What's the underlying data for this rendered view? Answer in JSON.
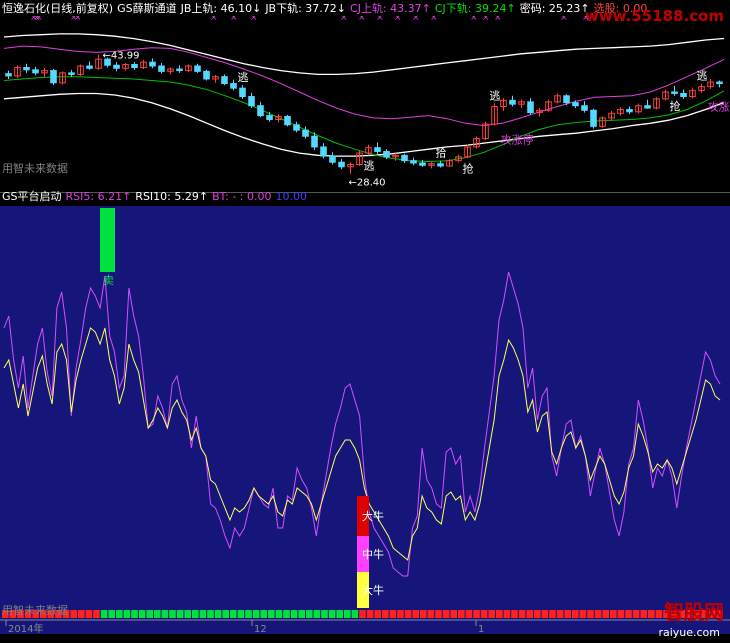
{
  "colors": {
    "bg": "#000000",
    "sub_bg": "#16167a",
    "grid": "#5a5a5a",
    "up": "#ff4040",
    "down": "#54d8ff",
    "white_line": "#ffffff",
    "magenta": "#e040e0",
    "green": "#00c000",
    "yellow": "#ffff60",
    "purple_rsi": "#d050ff",
    "red_bar": "#e00000",
    "green_bar": "#00e040"
  },
  "top_header": {
    "items": [
      {
        "text": "恒逸石化(日线,前复权)",
        "color": "#ffffff"
      },
      {
        "text": "GS薛斯通道",
        "color": "#ffffff"
      },
      {
        "text": "JB上轨: 46.10↓",
        "color": "#ffffff"
      },
      {
        "text": "JB下轨: 37.72↓",
        "color": "#ffffff"
      },
      {
        "text": "CJ上轨: 43.37↑",
        "color": "#e040e0"
      },
      {
        "text": "CJ下轨: 39.24↑",
        "color": "#00e000"
      },
      {
        "text": "密码: 25.23↑",
        "color": "#ffffff"
      },
      {
        "text": "选股: 0.00",
        "color": "#ff4040"
      }
    ]
  },
  "watermark_top": "www.55188.com",
  "watermark_bottom": {
    "cn": "智股网",
    "en": "raiyue.com"
  },
  "sub_header": {
    "items": [
      {
        "text": "GS平台启动",
        "color": "#ffffff"
      },
      {
        "text": "RSI5: 6.21↑",
        "color": "#e040e0"
      },
      {
        "text": "RSI10: 5.29↑",
        "color": "#ffffff"
      },
      {
        "text": "BT: - : 0.00",
        "color": "#e040e0"
      },
      {
        "text": "10.00",
        "color": "#4040ff"
      }
    ]
  },
  "annotations": {
    "price_high": "←43.99",
    "price_low": "←28.40",
    "main_note": "用智未来数据",
    "sub_note": "用智未来数据",
    "x_labels": [
      "2014年",
      "12",
      "1"
    ]
  },
  "chart_data": [
    {
      "type": "candlestick",
      "title": "恒逸石化(日线,前复权)",
      "indicator": "GS薛斯通道",
      "ylim": [
        26,
        48
      ],
      "candles": [
        [
          41.5,
          41.9,
          40.8,
          41.2
        ],
        [
          41.2,
          42.6,
          40.9,
          42.3
        ],
        [
          42.3,
          42.8,
          41.6,
          42.0
        ],
        [
          42.0,
          42.4,
          41.3,
          41.6
        ],
        [
          41.6,
          42.2,
          41.0,
          41.9
        ],
        [
          41.9,
          42.1,
          40.0,
          40.3
        ],
        [
          40.3,
          41.8,
          40.1,
          41.6
        ],
        [
          41.6,
          42.0,
          41.1,
          41.4
        ],
        [
          41.4,
          42.7,
          41.2,
          42.5
        ],
        [
          42.5,
          43.1,
          42.0,
          42.2
        ],
        [
          42.2,
          43.99,
          42.0,
          43.4
        ],
        [
          43.4,
          43.6,
          42.3,
          42.6
        ],
        [
          42.6,
          43.0,
          41.8,
          42.2
        ],
        [
          42.2,
          42.9,
          41.9,
          42.7
        ],
        [
          42.7,
          43.0,
          42.0,
          42.3
        ],
        [
          42.3,
          43.3,
          42.1,
          43.0
        ],
        [
          43.0,
          43.5,
          42.2,
          42.5
        ],
        [
          42.5,
          42.9,
          41.5,
          41.8
        ],
        [
          41.8,
          42.3,
          41.4,
          42.1
        ],
        [
          42.1,
          42.6,
          41.6,
          41.9
        ],
        [
          41.9,
          42.7,
          41.7,
          42.5
        ],
        [
          42.5,
          42.8,
          41.6,
          41.8
        ],
        [
          41.8,
          42.0,
          40.6,
          40.8
        ],
        [
          40.8,
          41.3,
          40.3,
          41.1
        ],
        [
          41.1,
          41.4,
          40.0,
          40.2
        ],
        [
          40.2,
          40.7,
          39.3,
          39.6
        ],
        [
          39.6,
          40.0,
          38.2,
          38.5
        ],
        [
          38.5,
          39.0,
          37.0,
          37.3
        ],
        [
          37.3,
          37.8,
          35.8,
          36.0
        ],
        [
          36.0,
          36.5,
          35.2,
          35.5
        ],
        [
          35.5,
          36.2,
          35.1,
          35.9
        ],
        [
          35.9,
          36.1,
          34.6,
          34.8
        ],
        [
          34.8,
          35.2,
          33.8,
          34.1
        ],
        [
          34.1,
          34.6,
          33.0,
          33.3
        ],
        [
          33.3,
          33.8,
          31.5,
          31.9
        ],
        [
          31.9,
          32.4,
          30.4,
          30.7
        ],
        [
          30.7,
          31.2,
          29.6,
          29.9
        ],
        [
          29.9,
          30.3,
          29.0,
          29.3
        ],
        [
          29.3,
          29.9,
          28.4,
          29.6
        ],
        [
          29.6,
          31.4,
          29.4,
          31.1
        ],
        [
          31.1,
          32.2,
          30.8,
          31.8
        ],
        [
          31.8,
          32.5,
          31.0,
          31.3
        ],
        [
          31.3,
          31.6,
          30.3,
          30.6
        ],
        [
          30.6,
          31.1,
          30.1,
          30.8
        ],
        [
          30.8,
          31.0,
          29.8,
          30.1
        ],
        [
          30.1,
          30.5,
          29.5,
          29.8
        ],
        [
          29.8,
          30.2,
          29.3,
          29.5
        ],
        [
          29.5,
          29.9,
          29.1,
          29.7
        ],
        [
          29.7,
          30.1,
          29.2,
          29.4
        ],
        [
          29.4,
          30.3,
          29.3,
          30.1
        ],
        [
          30.1,
          30.9,
          29.9,
          30.6
        ],
        [
          30.6,
          32.2,
          30.4,
          31.9
        ],
        [
          31.9,
          33.3,
          31.7,
          33.0
        ],
        [
          33.0,
          35.2,
          32.8,
          34.9
        ],
        [
          34.9,
          37.6,
          34.7,
          37.2
        ],
        [
          37.2,
          38.3,
          36.6,
          38.0
        ],
        [
          38.0,
          38.6,
          37.2,
          37.5
        ],
        [
          37.5,
          38.1,
          37.0,
          37.8
        ],
        [
          37.8,
          38.3,
          36.1,
          36.4
        ],
        [
          36.4,
          37.0,
          35.9,
          36.7
        ],
        [
          36.7,
          38.1,
          36.5,
          37.8
        ],
        [
          37.8,
          38.9,
          37.6,
          38.6
        ],
        [
          38.6,
          38.8,
          37.4,
          37.7
        ],
        [
          37.7,
          38.0,
          37.0,
          37.3
        ],
        [
          37.3,
          37.9,
          36.4,
          36.7
        ],
        [
          36.7,
          36.9,
          34.3,
          34.6
        ],
        [
          34.6,
          35.9,
          34.4,
          35.7
        ],
        [
          35.7,
          36.6,
          35.3,
          36.3
        ],
        [
          36.3,
          37.1,
          36.0,
          36.8
        ],
        [
          36.8,
          37.2,
          36.2,
          36.5
        ],
        [
          36.5,
          37.6,
          36.3,
          37.3
        ],
        [
          37.3,
          38.1,
          36.9,
          37.0
        ],
        [
          37.0,
          38.4,
          36.8,
          38.2
        ],
        [
          38.2,
          39.4,
          38.0,
          39.1
        ],
        [
          39.1,
          39.9,
          38.6,
          38.9
        ],
        [
          38.9,
          39.4,
          38.2,
          38.5
        ],
        [
          38.5,
          39.6,
          38.3,
          39.3
        ],
        [
          39.3,
          40.2,
          39.0,
          39.8
        ],
        [
          39.8,
          40.8,
          39.5,
          40.4
        ],
        [
          40.4,
          40.6,
          39.7,
          40.2
        ]
      ],
      "jb_upper": [
        46.3,
        46.5,
        46.6,
        46.7,
        46.7,
        46.6,
        46.4,
        46.1,
        45.7,
        45.2,
        44.6,
        44.0,
        43.4,
        42.8,
        42.3,
        41.9,
        41.6,
        41.4,
        41.4,
        41.5,
        41.7,
        42.0,
        42.3,
        42.6,
        42.9,
        43.2,
        43.5,
        43.8,
        44.1,
        44.3,
        44.5,
        44.7,
        44.8,
        44.9,
        45.0,
        45.1,
        45.3,
        45.6,
        45.9,
        46.1
      ],
      "jb_lower": [
        38.2,
        38.4,
        38.6,
        38.8,
        38.9,
        38.9,
        38.7,
        38.3,
        37.7,
        36.9,
        36.0,
        35.0,
        34.0,
        33.1,
        32.3,
        31.6,
        31.1,
        30.8,
        30.7,
        30.7,
        30.8,
        31.0,
        31.3,
        31.6,
        31.9,
        32.1,
        32.4,
        32.7,
        33.0,
        33.3,
        33.5,
        33.7,
        34.0,
        34.3,
        34.7,
        35.0,
        35.4,
        36.0,
        36.8,
        37.72
      ],
      "cj_upper": [
        44.8,
        45.1,
        45.0,
        44.7,
        44.4,
        44.3,
        44.4,
        44.7,
        44.9,
        44.8,
        44.3,
        43.6,
        42.9,
        42.1,
        41.2,
        40.2,
        39.1,
        38.0,
        37.0,
        36.2,
        35.7,
        35.6,
        35.8,
        36.0,
        35.6,
        35.0,
        34.7,
        35.0,
        35.7,
        36.5,
        37.2,
        37.9,
        38.4,
        38.5,
        38.6,
        39.1,
        40.0,
        41.1,
        42.2,
        43.37
      ],
      "cj_lower": [
        40.6,
        40.8,
        41.0,
        41.1,
        41.1,
        41.0,
        40.9,
        40.8,
        40.6,
        40.4,
        40.0,
        39.4,
        38.6,
        37.7,
        36.7,
        35.6,
        34.5,
        33.4,
        32.4,
        31.6,
        30.9,
        30.4,
        30.1,
        30.0,
        30.1,
        30.5,
        31.2,
        32.2,
        33.3,
        34.2,
        34.8,
        35.1,
        35.3,
        35.4,
        35.5,
        35.7,
        36.1,
        36.8,
        37.9,
        39.24
      ],
      "signals": [
        {
          "index": 26,
          "text": "逃",
          "color": "#ffffff"
        },
        {
          "index": 40,
          "text": "逃",
          "color": "#ffffff"
        },
        {
          "index": 48,
          "text": "拾",
          "color": "#ffffff"
        },
        {
          "index": 51,
          "text": "抢",
          "color": "#ffffff"
        },
        {
          "index": 54,
          "text": "逃",
          "color": "#ffffff"
        },
        {
          "index": 74,
          "text": "抢",
          "color": "#ffffff"
        },
        {
          "index": 77,
          "text": "逃",
          "color": "#ffffff"
        }
      ],
      "labels": [
        {
          "index": 54,
          "text": "攻涨停",
          "color": "#e040e0"
        },
        {
          "index": 77,
          "text": "攻涨停",
          "color": "#e040e0"
        }
      ],
      "x_marks": [
        [
          30,
          33,
          35
        ],
        [
          70,
          74
        ],
        [
          210,
          230,
          250
        ],
        [
          340,
          358,
          376,
          394,
          412,
          430
        ],
        [
          470,
          482,
          494
        ],
        [
          560,
          582
        ]
      ]
    },
    {
      "type": "line",
      "title": "GS平台启动",
      "ylim": [
        0,
        100
      ],
      "series": [
        {
          "name": "RSI5",
          "color": "#d050ff",
          "values": [
            70,
            73,
            62,
            55,
            63,
            50,
            58,
            66,
            70,
            59,
            53,
            75,
            79,
            70,
            48,
            60,
            67,
            75,
            80,
            78,
            75,
            83,
            68,
            64,
            55,
            58,
            80,
            73,
            68,
            58,
            45,
            46,
            53,
            50,
            45,
            56,
            58,
            52,
            49,
            40,
            48,
            40,
            38,
            26,
            25,
            22,
            18,
            15,
            20,
            18,
            20,
            25,
            30,
            28,
            26,
            25,
            30,
            20,
            20,
            28,
            27,
            35,
            32,
            30,
            25,
            18,
            26,
            33,
            40,
            46,
            50,
            55,
            56,
            52,
            48,
            33,
            24,
            20,
            18,
            16,
            14,
            10,
            9,
            8,
            8,
            20,
            23,
            40,
            32,
            30,
            26,
            25,
            39,
            40,
            36,
            38,
            24,
            28,
            24,
            30,
            40,
            49,
            58,
            72,
            77,
            84,
            80,
            76,
            70,
            55,
            60,
            47,
            53,
            55,
            38,
            33,
            40,
            46,
            47,
            40,
            43,
            38,
            28,
            34,
            40,
            36,
            29,
            22,
            18,
            24,
            36,
            40,
            52,
            47,
            40,
            30,
            35,
            33,
            37,
            33,
            25,
            33,
            40,
            46,
            52,
            58,
            64,
            62,
            58,
            56
          ]
        },
        {
          "name": "RSI10",
          "color": "#ffff60",
          "values": [
            60,
            62,
            56,
            50,
            56,
            48,
            54,
            60,
            63,
            56,
            51,
            64,
            66,
            62,
            49,
            57,
            62,
            66,
            70,
            69,
            66,
            70,
            62,
            58,
            51,
            55,
            66,
            62,
            59,
            52,
            45,
            47,
            50,
            48,
            45,
            50,
            52,
            49,
            47,
            42,
            45,
            40,
            38,
            32,
            31,
            28,
            25,
            22,
            25,
            24,
            25,
            27,
            30,
            28,
            27,
            26,
            28,
            24,
            23,
            27,
            26,
            30,
            29,
            28,
            26,
            22,
            26,
            30,
            34,
            38,
            40,
            42,
            42,
            40,
            37,
            30,
            26,
            24,
            22,
            20,
            18,
            15,
            14,
            13,
            12,
            18,
            20,
            28,
            25,
            24,
            22,
            21,
            28,
            29,
            27,
            28,
            22,
            24,
            22,
            26,
            33,
            40,
            47,
            58,
            62,
            67,
            65,
            62,
            58,
            49,
            52,
            44,
            48,
            49,
            39,
            36,
            40,
            43,
            44,
            40,
            42,
            38,
            32,
            35,
            38,
            36,
            32,
            28,
            26,
            29,
            35,
            38,
            46,
            43,
            39,
            34,
            36,
            35,
            37,
            35,
            31,
            35,
            39,
            43,
            47,
            52,
            57,
            56,
            53,
            52
          ]
        }
      ],
      "bars": [
        {
          "text": "卖",
          "color": "#00e040",
          "top": 100,
          "bottom": 84
        },
        {
          "text": "大牛",
          "color": "#e00000",
          "top": 28,
          "bottom": 18
        },
        {
          "text": "中牛",
          "color": "#ff40ff",
          "top": 18,
          "bottom": 9
        },
        {
          "text": "大牛",
          "color": "#ffff40",
          "top": 9,
          "bottom": 0
        }
      ],
      "bottom_strip": {
        "colors": [
          "#ff2020",
          "#00e040"
        ],
        "pattern": [
          0,
          0,
          0,
          0,
          0,
          0,
          0,
          0,
          0,
          0,
          0,
          0,
          0,
          1,
          1,
          1,
          1,
          1,
          1,
          1,
          1,
          1,
          1,
          1,
          1,
          1,
          1,
          1,
          1,
          1,
          1,
          1,
          1,
          1,
          1,
          1,
          1,
          1,
          1,
          1,
          1,
          1,
          1,
          1,
          1,
          1,
          1,
          0,
          0,
          0,
          0,
          0,
          0,
          0,
          0,
          0,
          0,
          0,
          0,
          0,
          0,
          0,
          0,
          0,
          0,
          0,
          0,
          0,
          0,
          0,
          0,
          0,
          0,
          0,
          0,
          0,
          0,
          0,
          0,
          0,
          0,
          0,
          0,
          0,
          0,
          0,
          0,
          0,
          0,
          0,
          0,
          0,
          0,
          0,
          0
        ]
      }
    }
  ]
}
